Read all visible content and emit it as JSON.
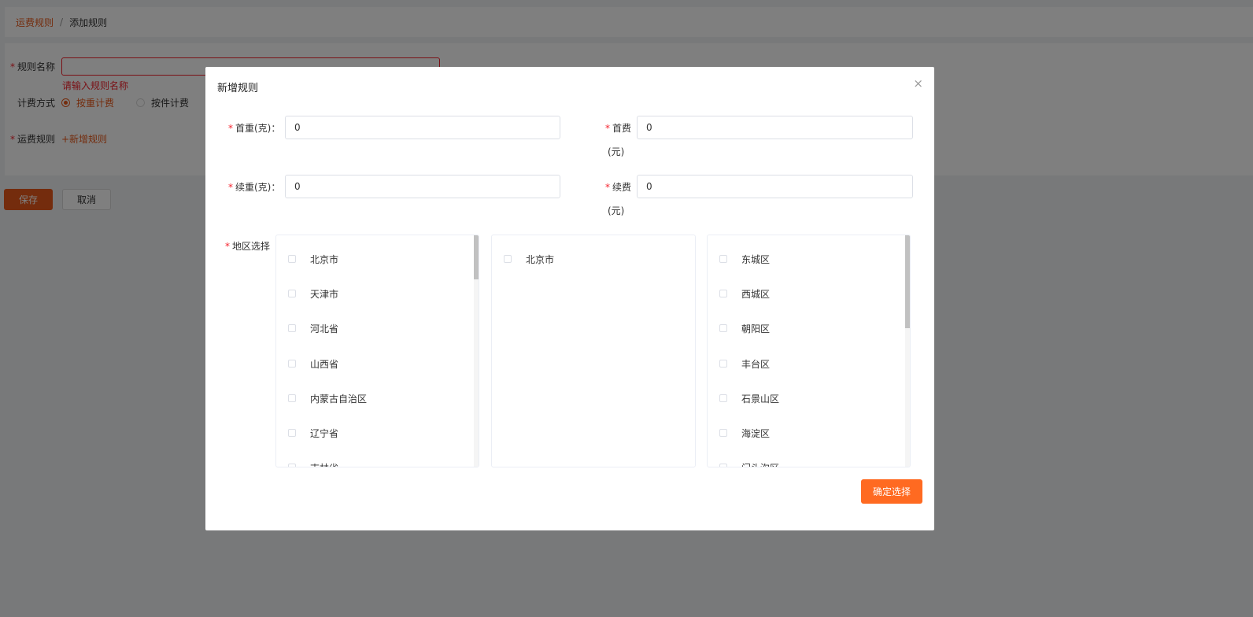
{
  "breadcrumb": {
    "link": "运费规则",
    "separator": "/",
    "current": "添加规则"
  },
  "form": {
    "rule_name_label": "规则名称",
    "rule_name_value": "",
    "rule_name_error": "请输入规则名称",
    "billing_label": "计费方式",
    "billing_options": [
      "按重计费",
      "按件计费"
    ],
    "billing_selected": "按重计费",
    "shipping_rule_label": "运费规则",
    "add_rule_link": "+新增规则",
    "required_mark": "*"
  },
  "actions": {
    "save": "保存",
    "cancel": "取消"
  },
  "modal": {
    "title": "新增规则",
    "close": "×",
    "first_weight_label": "首重(克)：",
    "first_weight_value": "0",
    "first_fee_label": "首费",
    "first_fee_unit": "(元)",
    "first_fee_value": "0",
    "extra_weight_label": "续重(克)：",
    "extra_weight_value": "0",
    "extra_fee_label": "续费",
    "extra_fee_unit": "(元)",
    "extra_fee_value": "0",
    "region_label": "地区选择",
    "provinces": [
      "北京市",
      "天津市",
      "河北省",
      "山西省",
      "内蒙古自治区",
      "辽宁省",
      "吉林省"
    ],
    "cities": [
      "北京市"
    ],
    "districts": [
      "东城区",
      "西城区",
      "朝阳区",
      "丰台区",
      "石景山区",
      "海淀区",
      "门头沟区"
    ],
    "confirm": "确定选择"
  },
  "colors": {
    "accent": "#e8591a",
    "confirm": "#ff6a21",
    "error": "#f5222d",
    "mask": "rgba(0,0,0,0.5)"
  }
}
